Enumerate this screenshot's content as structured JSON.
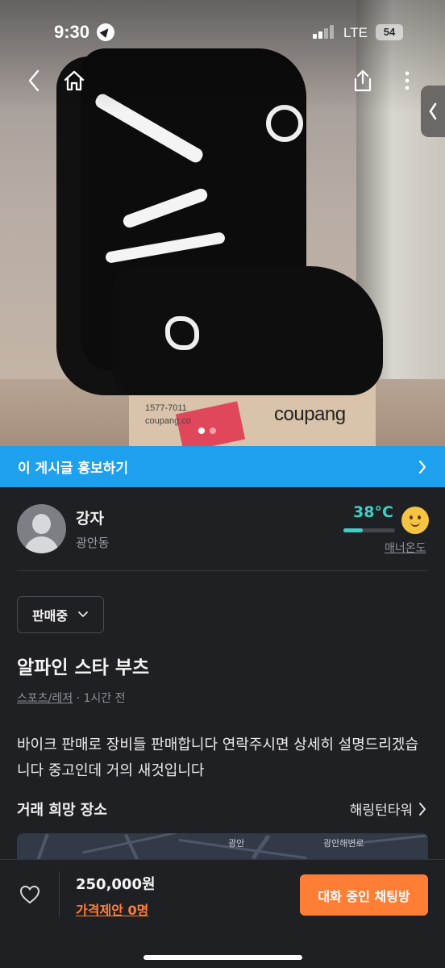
{
  "status_bar": {
    "time": "9:30",
    "network": "LTE",
    "battery": "54"
  },
  "photo": {
    "box_phone": "1577-7011",
    "box_site": "coupang.co",
    "box_brand": "coupang",
    "image_count": 2,
    "current_index": 1
  },
  "promo": {
    "label": "이 게시글 홍보하기"
  },
  "seller": {
    "name": "강자",
    "location": "광안동",
    "temperature": "38°C",
    "temperature_level": 0.38,
    "temperature_label": "매너온도"
  },
  "post": {
    "status": "판매중",
    "title": "알파인 스타 부츠",
    "category": "스포츠/레저",
    "time_ago": "· 1시간 전",
    "description": "바이크 판매로 장비들 판매합니다 연락주시면 상세히 설명드리겠습니다 중고인데 거의 새것입니다",
    "place_label": "거래 희망 장소",
    "place_value": "해링턴타워"
  },
  "map": {
    "labels": [
      "광안",
      "광안해변로"
    ]
  },
  "bottom_bar": {
    "price": "250,000원",
    "offer": "가격제안 0명",
    "chat_button": "대화 중인 채팅방"
  },
  "colors": {
    "accent": "#ff7e36",
    "promo": "#1da0ee",
    "temperature": "#3fd1c6"
  }
}
